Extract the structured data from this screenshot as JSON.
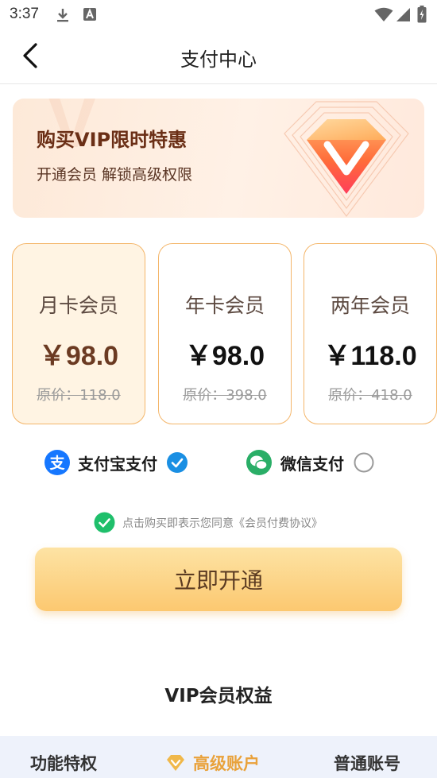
{
  "status_bar": {
    "time": "3:37",
    "icons": [
      "download-icon",
      "a-badge-icon",
      "wifi-icon",
      "signal-icon",
      "battery-icon"
    ]
  },
  "header": {
    "title": "支付中心",
    "back_icon": "chevron-left-icon"
  },
  "banner": {
    "title": "购买VIP限时特惠",
    "subtitle": "开通会员  解锁高级权限",
    "icon": "vip-gem-icon",
    "deco_text": "V"
  },
  "plans": [
    {
      "name": "月卡会员",
      "price": "￥98.0",
      "original": "原价：118.0",
      "selected": true
    },
    {
      "name": "年卡会员",
      "price": "￥98.0",
      "original": "原价：398.0",
      "selected": false
    },
    {
      "name": "两年会员",
      "price": "￥118.0",
      "original": "原价：418.0",
      "selected": false
    }
  ],
  "payment": {
    "alipay_label": "支付宝支付",
    "wechat_label": "微信支付",
    "selected": "alipay"
  },
  "agreement": {
    "text": "点击购买即表示您同意《会员付费协议》",
    "checked": true
  },
  "open_button": {
    "label": "立即开通"
  },
  "benefits": {
    "title": "VIP会员权益",
    "tabs": [
      "功能特权",
      "高级账户",
      "普通账号"
    ],
    "active_tab": 1
  },
  "colors": {
    "accent": "#f4b66a",
    "price_selected": "#6b3a22",
    "alipay_blue": "#1677ff",
    "wechat_green": "#2aae67",
    "check_blue": "#1a8fe3",
    "agree_green": "#1fbf6b",
    "tab_active": "#e9a23b"
  }
}
